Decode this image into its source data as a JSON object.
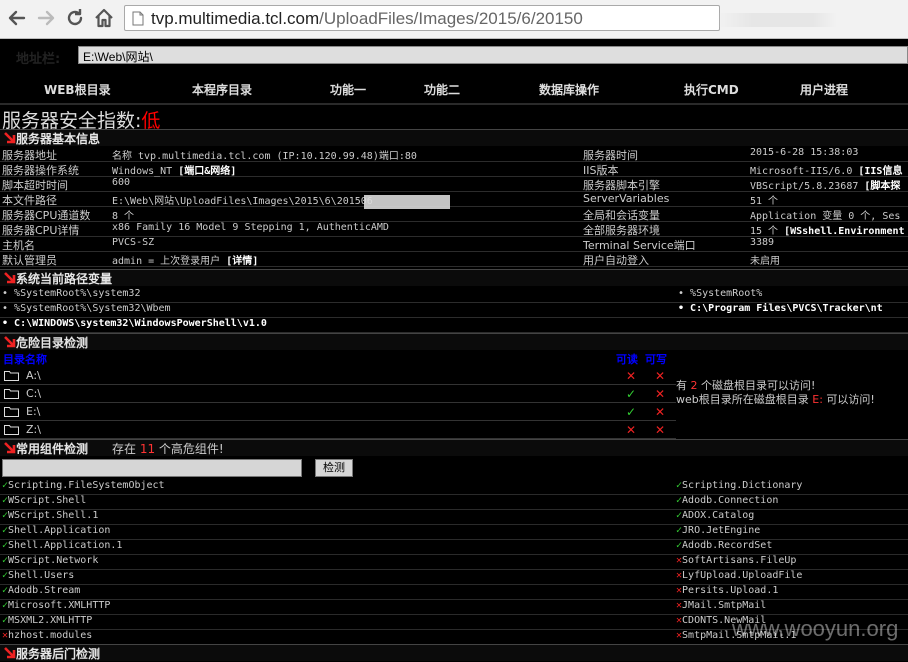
{
  "browser": {
    "url_host": "tvp.multimedia.tcl.com",
    "url_path": "/UploadFiles/Images/2015/6/20150"
  },
  "address": {
    "label": "地址栏:",
    "value": "E:\\Web\\网站\\"
  },
  "menu": [
    "WEB根目录",
    "本程序目录",
    "功能一",
    "功能二",
    "数据库操作",
    "执行CMD",
    "用户进程"
  ],
  "security": {
    "label": "服务器安全指数:",
    "level": "低"
  },
  "basic": {
    "title": "服务器基本信息",
    "rows": [
      {
        "l1": "服务器地址",
        "v1": "名称 tvp.multimedia.tcl.com (IP:10.120.99.48)端口:80",
        "v1b": "",
        "l2": "服务器时间",
        "v2": "2015-6-28 15:38:03",
        "v2b": ""
      },
      {
        "l1": "服务器操作系统",
        "v1": "Windows_NT ",
        "v1b": "[端口&网络]",
        "l2": "IIS版本",
        "v2": "Microsoft-IIS/6.0 ",
        "v2b": "[IIS信息"
      },
      {
        "l1": "脚本超时时间",
        "v1": "600",
        "v1b": "",
        "l2": "服务器脚本引擎",
        "v2": "VBScript/5.8.23687 ",
        "v2b": "[脚本探"
      },
      {
        "l1": "本文件路径",
        "v1": "E:\\Web\\网站\\UploadFiles\\Images\\2015\\6\\201506",
        "v1b": "",
        "l2": "ServerVariables",
        "v2": "51 个",
        "v2b": ""
      },
      {
        "l1": "服务器CPU通道数",
        "v1": "8 个",
        "v1b": "",
        "l2": "全局和会话变量",
        "v2": "Application 变量 0 个, Ses",
        "v2b": ""
      },
      {
        "l1": "服务器CPU详情",
        "v1": "x86 Family 16 Model 9 Stepping 1, AuthenticAMD",
        "v1b": "",
        "l2": "全部服务器环境",
        "v2": "15 个 ",
        "v2b": "[WSshell.Environment"
      },
      {
        "l1": "主机名",
        "v1": "PVCS-SZ",
        "v1b": "",
        "l2": "Terminal Service端口",
        "v2": "3389",
        "v2b": ""
      },
      {
        "l1": "默认管理员",
        "v1": "admin = 上次登录用户  ",
        "v1b": "[详情]",
        "l2": "用户自动登入",
        "v2": "未启用",
        "v2b": ""
      }
    ]
  },
  "paths": {
    "title": "系统当前路径变量",
    "rows": [
      {
        "a": "%SystemRoot%\\system32",
        "ab": false,
        "b": "%SystemRoot%",
        "bb": false
      },
      {
        "a": "%SystemRoot%\\System32\\Wbem",
        "ab": false,
        "b": "C:\\Program Files\\PVCS\\Tracker\\nt",
        "bb": true
      },
      {
        "a": "C:\\WINDOWS\\system32\\WindowsPowerShell\\v1.0",
        "ab": true,
        "b": "",
        "bb": false
      }
    ]
  },
  "dirs": {
    "title": "危险目录检测",
    "col_name": "目录名称",
    "col_read": "可读",
    "col_write": "可写",
    "rows": [
      {
        "name": "A:\\",
        "read": "✕",
        "write": "✕",
        "read_ok": false,
        "write_ok": false
      },
      {
        "name": "C:\\",
        "read": "✓",
        "write": "✕",
        "read_ok": true,
        "write_ok": false
      },
      {
        "name": "E:\\",
        "read": "✓",
        "write": "✕",
        "read_ok": true,
        "write_ok": false
      },
      {
        "name": "Z:\\",
        "read": "✕",
        "write": "✕",
        "read_ok": false,
        "write_ok": false
      }
    ],
    "info1_a": "有 ",
    "info1_num": "2",
    "info1_b": " 个磁盘根目录可以访问!",
    "info2_a": "web根目录所在磁盘根目录 ",
    "info2_drive": "E:",
    "info2_b": " 可以访问!"
  },
  "components": {
    "title": "常用组件检测",
    "count_a": "存在 ",
    "count_num": "11",
    "count_b": " 个高危组件!",
    "check_button": "检测",
    "rows": [
      {
        "a": "Scripting.FileSystemObject",
        "aok": true,
        "b": "Scripting.Dictionary",
        "bok": true
      },
      {
        "a": "WScript.Shell",
        "aok": true,
        "b": "Adodb.Connection",
        "bok": true
      },
      {
        "a": "WScript.Shell.1",
        "aok": true,
        "b": "ADOX.Catalog",
        "bok": true
      },
      {
        "a": "Shell.Application",
        "aok": true,
        "b": "JRO.JetEngine",
        "bok": true
      },
      {
        "a": "Shell.Application.1",
        "aok": true,
        "b": "Adodb.RecordSet",
        "bok": true
      },
      {
        "a": "WScript.Network",
        "aok": true,
        "b": "SoftArtisans.FileUp",
        "bok": false
      },
      {
        "a": "Shell.Users",
        "aok": true,
        "b": "LyfUpload.UploadFile",
        "bok": false
      },
      {
        "a": "Adodb.Stream",
        "aok": true,
        "b": "Persits.Upload.1",
        "bok": false
      },
      {
        "a": "Microsoft.XMLHTTP",
        "aok": true,
        "b": "JMail.SmtpMail",
        "bok": false
      },
      {
        "a": "MSXML2.XMLHTTP",
        "aok": true,
        "b": "CDONTS.NewMail",
        "bok": false
      },
      {
        "a": "hzhost.modules",
        "aok": false,
        "b": "SmtpMail.SmtpMail.1",
        "bok": false
      }
    ]
  },
  "backdoor": {
    "title": "服务器后门检测"
  },
  "watermark": "www.wooyun.org",
  "colors": {
    "ok": "#33cc33",
    "bad": "#ee2222",
    "accent_red": "#ff0000",
    "header_blue": "#0000ff"
  }
}
